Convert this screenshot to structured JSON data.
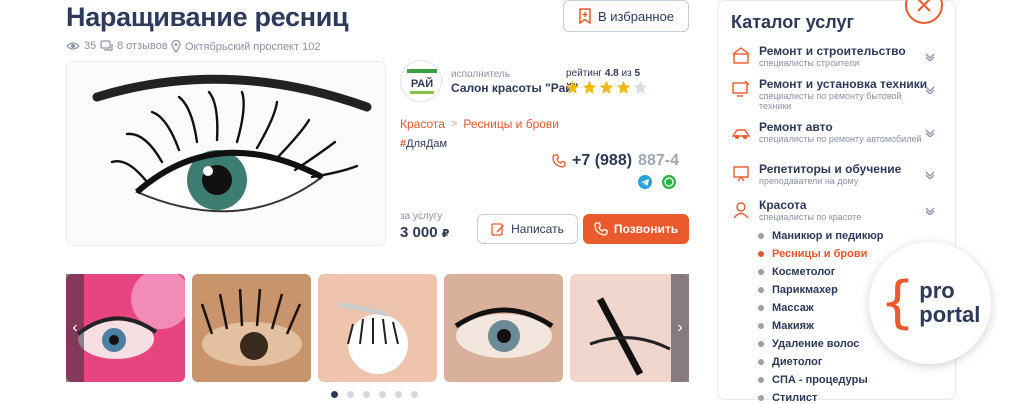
{
  "title": "Наращивание ресниц",
  "favorite_label": "В избранное",
  "meta": {
    "views": "35",
    "reviews": "8 отзывов",
    "address": "Октябрьский проспект 102"
  },
  "performer": {
    "label": "исполнитель",
    "name": "Салон красоты \"Рай\"",
    "logo_text": "РАЙ"
  },
  "rating": {
    "prefix": "рейтинг",
    "value": "4.8",
    "of": "из",
    "max": "5",
    "stars_filled": 4,
    "stars_total": 5
  },
  "breadcrumbs": [
    "Красота",
    "Ресницы и брови"
  ],
  "tag": "ДляДам",
  "phone": {
    "visible": "+7 (988)",
    "faded": "887-4"
  },
  "price": {
    "label": "за услугу",
    "value": "3 000",
    "currency": "₽"
  },
  "buttons": {
    "write": "Написать",
    "call": "Позвонить"
  },
  "gallery": {
    "dots_total": 6,
    "active_dot": 0
  },
  "catalog": {
    "title": "Каталог услуг",
    "items": [
      {
        "name": "Ремонт и строительство",
        "sub": "специалисты строители",
        "icon": "construction-icon"
      },
      {
        "name": "Ремонт и установка техники",
        "sub": "специалисты по ремонту бытовой техники",
        "icon": "appliance-repair-icon"
      },
      {
        "name": "Ремонт авто",
        "sub": "специалисты по ремонту автомобилей",
        "icon": "car-repair-icon"
      },
      {
        "name": "Репетиторы и обучение",
        "sub": "преподаватели на дому",
        "icon": "tutor-icon"
      },
      {
        "name": "Красота",
        "sub": "специалисты по красоте",
        "icon": "beauty-icon"
      }
    ],
    "beauty_subitems": [
      "Маникюр и педикюр",
      "Ресницы и брови",
      "Косметолог",
      "Парикмахер",
      "Массаж",
      "Макияж",
      "Удаление волос",
      "Диетолог",
      "СПА - процедуры",
      "Стилист"
    ],
    "active_subitem": 1
  },
  "logo": {
    "line1": "pro",
    "line2": "portal",
    "brace": "{"
  },
  "colors": {
    "accent": "#ea5a2d",
    "text": "#2c3a58",
    "muted": "#8a93a6",
    "star": "#f3b811"
  }
}
